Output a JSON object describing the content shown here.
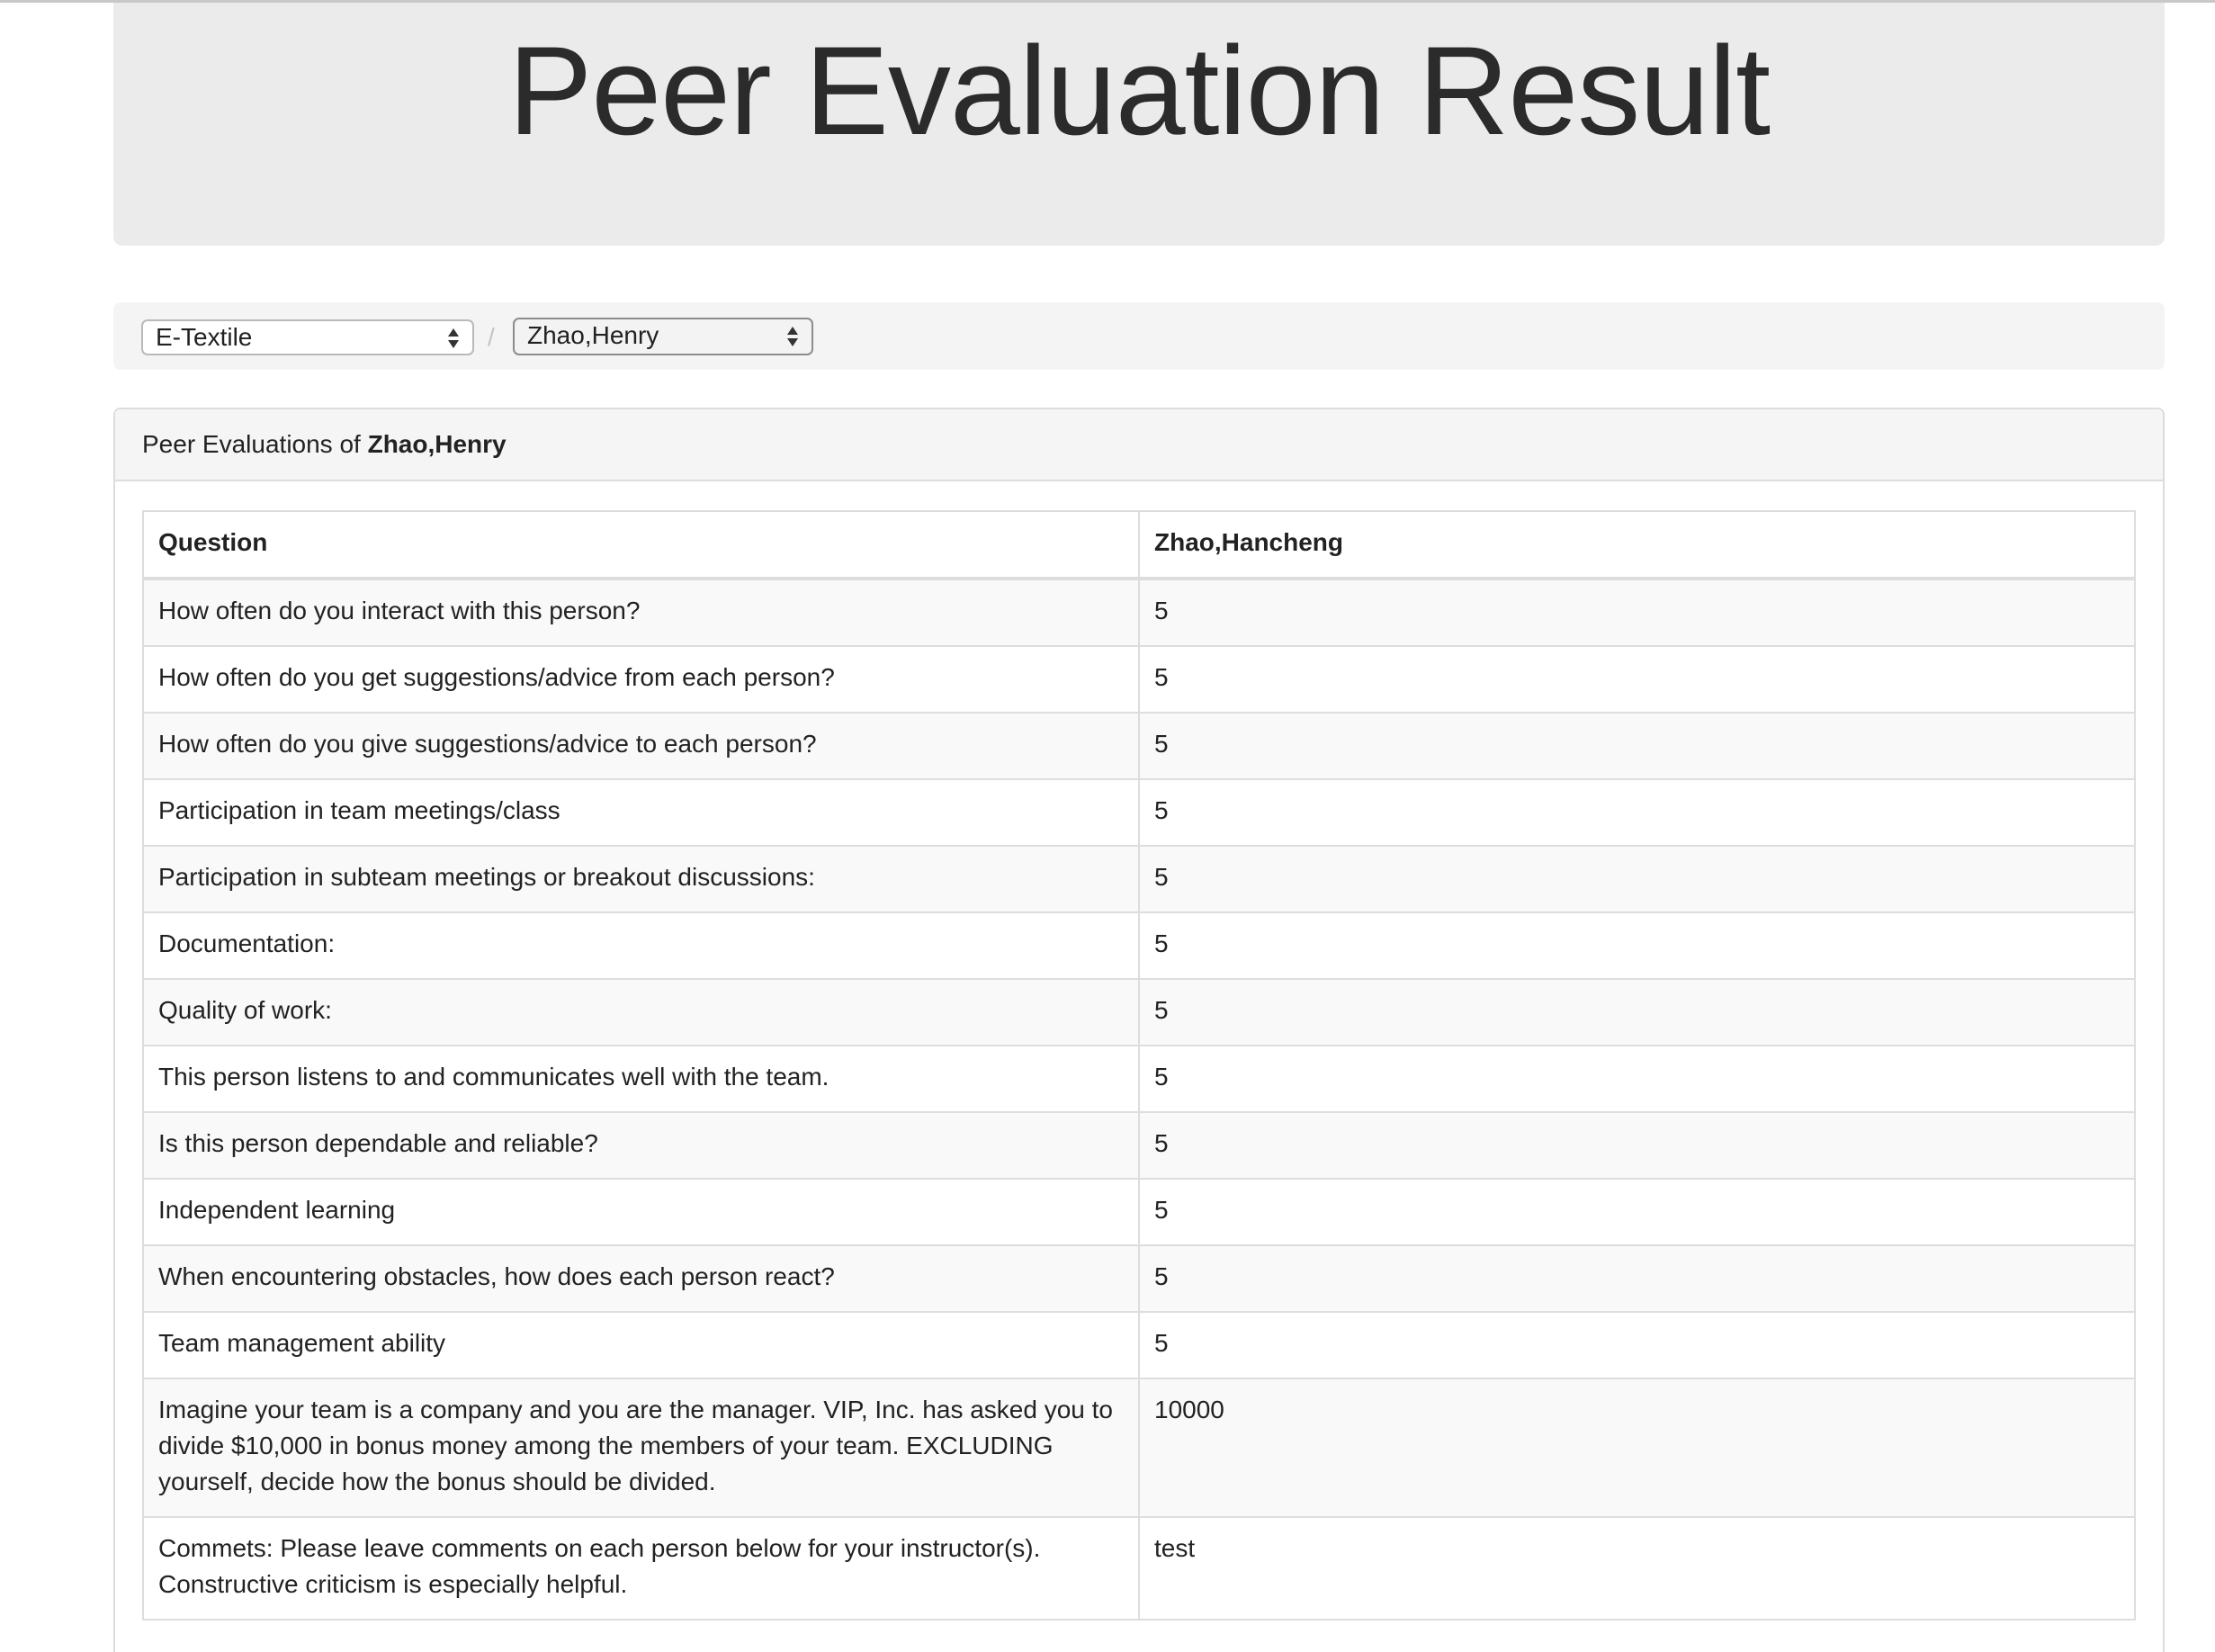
{
  "page": {
    "title": "Peer Evaluation Result"
  },
  "breadcrumb": {
    "course_select": "E-Textile",
    "separator": "/",
    "student_select": "Zhao,Henry"
  },
  "panel": {
    "heading_prefix": "Peer Evaluations of",
    "heading_name": "Zhao,Henry"
  },
  "table": {
    "headers": [
      "Question",
      "Zhao,Hancheng"
    ],
    "rows": [
      {
        "question": "How often do you interact with this person?",
        "answer": "5"
      },
      {
        "question": "How often do you get suggestions/advice from each person?",
        "answer": "5"
      },
      {
        "question": "How often do you give suggestions/advice to each person?",
        "answer": "5"
      },
      {
        "question": "Participation in team meetings/class",
        "answer": "5"
      },
      {
        "question": "Participation in subteam meetings or breakout discussions:",
        "answer": "5"
      },
      {
        "question": "Documentation:",
        "answer": "5"
      },
      {
        "question": "Quality of work:",
        "answer": "5"
      },
      {
        "question": "This person listens to and communicates well with the team.",
        "answer": "5"
      },
      {
        "question": "Is this person dependable and reliable?",
        "answer": "5"
      },
      {
        "question": "Independent learning",
        "answer": "5"
      },
      {
        "question": "When encountering obstacles, how does each person react?",
        "answer": "5"
      },
      {
        "question": "Team management ability",
        "answer": "5"
      },
      {
        "question": "Imagine your team is a company and you are the manager. VIP, Inc. has asked you to divide $10,000 in bonus money among the members of your team. EXCLUDING yourself, decide how the bonus should be divided.",
        "answer": "10000"
      },
      {
        "question": "Commets: Please leave comments on each person below for your instructor(s). Constructive criticism is especially helpful.",
        "answer": "test"
      }
    ]
  }
}
